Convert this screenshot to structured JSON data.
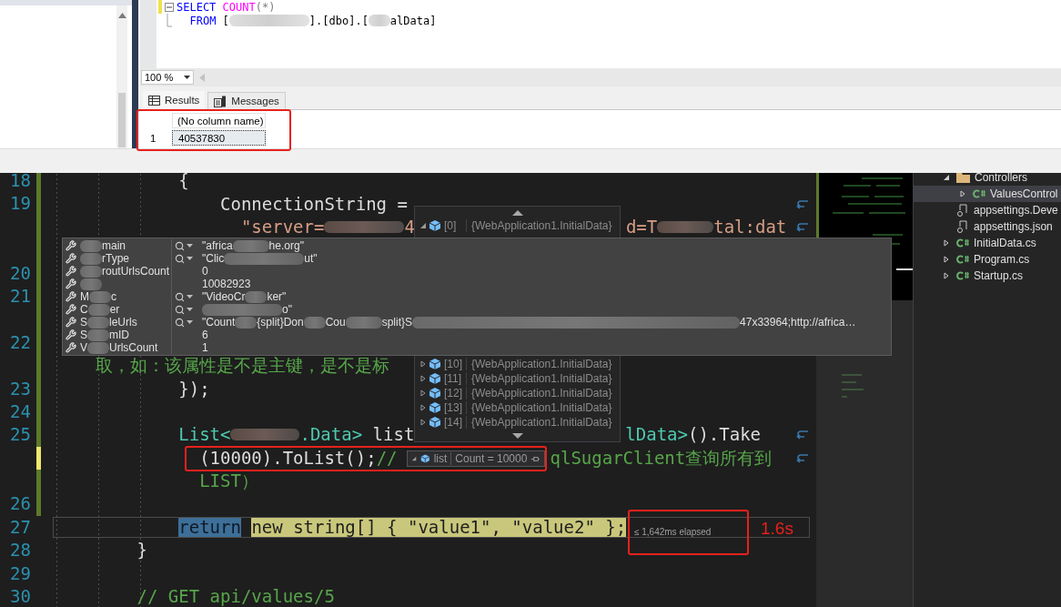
{
  "query_editor": {
    "lines": [
      {
        "changed": true,
        "saved": false,
        "fold": true,
        "segments": [
          {
            "kind": "keyword",
            "text": "SELECT"
          },
          {
            "kind": "function",
            "text": " COUNT"
          },
          {
            "kind": "operator",
            "text": "(*)"
          }
        ]
      },
      {
        "segments": [
          {
            "kind": "keyword",
            "text": "  FROM"
          },
          {
            "kind": "plain",
            "text": " ["
          },
          {
            "kind": "redacted"
          },
          {
            "kind": "plain",
            "text": "].[dbo].["
          },
          {
            "kind": "redacted"
          },
          {
            "kind": "plain",
            "text": "alData]"
          }
        ]
      }
    ]
  },
  "zoom_level": "100 %",
  "result_tabs": [
    {
      "label": "Results",
      "selected": true
    },
    {
      "label": "Messages",
      "selected": false
    }
  ],
  "results": {
    "columns": [
      "(No column name)"
    ],
    "rows": [
      {
        "number": "1",
        "cells": [
          "40537830"
        ],
        "selected": true
      }
    ]
  },
  "code_lines": [
    {
      "number": "18",
      "changed": true,
      "saved": true,
      "segments": [
        {
          "kind": "plain",
          "text": "            {"
        }
      ]
    },
    {
      "number": "19",
      "changed": true,
      "saved": true,
      "wrap": true,
      "segments": [
        {
          "kind": "plain",
          "text": "                ConnectionString ="
        }
      ]
    },
    {
      "changed": true,
      "saved": true,
      "wrap": true,
      "segments": [
        {
          "kind": "string",
          "text": "                  \"server="
        },
        {
          "kind": "redacted"
        },
        {
          "kind": "string",
          "text": "4"
        },
        {
          "kind": "gap"
        },
        {
          "kind": "string",
          "text": "d=T"
        },
        {
          "kind": "redacted"
        },
        {
          "kind": "string",
          "text": "tal:dat"
        }
      ]
    },
    {
      "changed": true,
      "saved": true
    },
    {
      "number": "20",
      "changed": true,
      "saved": true
    },
    {
      "number": "21",
      "changed": true,
      "saved": true
    },
    {
      "changed": true,
      "saved": true
    },
    {
      "number": "22",
      "changed": true,
      "saved": true
    },
    {
      "changed": true,
      "saved": true,
      "segments": [
        {
          "kind": "comment",
          "text": "    取，如：该属性是不是主键，是不是标"
        }
      ]
    },
    {
      "number": "23",
      "changed": true,
      "saved": true,
      "segments": [
        {
          "kind": "plain",
          "text": "            });"
        }
      ]
    },
    {
      "number": "24",
      "changed": true,
      "saved": true
    },
    {
      "number": "25",
      "changed": true,
      "saved": true,
      "wrap": true,
      "segments": [
        {
          "kind": "type",
          "text": "            List<"
        },
        {
          "kind": "redacted"
        },
        {
          "kind": "type",
          "text": ".Data>"
        },
        {
          "kind": "plain",
          "text": " list"
        },
        {
          "kind": "gap"
        },
        {
          "kind": "type",
          "text": "lData>"
        },
        {
          "kind": "plain",
          "text": "().Take"
        }
      ]
    },
    {
      "changed": true,
      "saved": false,
      "wrap": true,
      "segments": [
        {
          "kind": "plain",
          "text": "              (10000).ToList();"
        },
        {
          "kind": "comment",
          "text": "//"
        },
        {
          "kind": "gap"
        },
        {
          "kind": "comment",
          "text": "qlSugarClient查询所有到"
        }
      ]
    },
    {
      "changed": true,
      "saved": true,
      "segments": [
        {
          "kind": "comment",
          "text": "              LIST）"
        }
      ]
    },
    {
      "number": "26",
      "changed": true,
      "saved": true
    },
    {
      "number": "27",
      "current": true,
      "segments": [
        {
          "kind": "selected",
          "text": "            return"
        },
        {
          "kind": "current",
          "text": " new string[] { \"value1\", \"value2\" };"
        }
      ]
    },
    {
      "number": "28",
      "segments": [
        {
          "kind": "plain",
          "text": "        }"
        }
      ]
    },
    {
      "number": "29"
    },
    {
      "number": "30",
      "segments": [
        {
          "kind": "comment",
          "text": "        // GET api/values/5"
        }
      ]
    }
  ],
  "list_dropdown": [
    {
      "index": "[0]",
      "value": "{WebApplication1.InitialData}",
      "expanded": true
    },
    {
      "index": "[10]",
      "value": "{WebApplication1.InitialData}",
      "expanded": false
    },
    {
      "index": "[11]",
      "value": "{WebApplication1.InitialData}",
      "expanded": false
    },
    {
      "index": "[12]",
      "value": "{WebApplication1.InitialData}",
      "expanded": false
    },
    {
      "index": "[13]",
      "value": "{WebApplication1.InitialData}",
      "expanded": false
    },
    {
      "index": "[14]",
      "value": "{WebApplication1.InitialData}",
      "expanded": false
    }
  ],
  "property_tip": [
    {
      "kind": "string",
      "name": [
        {
          "kind": "redacted"
        },
        {
          "kind": "plain",
          "text": "main"
        }
      ],
      "value": [
        {
          "kind": "plain",
          "text": "\"africa"
        },
        {
          "kind": "redacted"
        },
        {
          "kind": "plain",
          "text": "he.org\""
        }
      ]
    },
    {
      "kind": "string",
      "name": [
        {
          "kind": "redacted"
        },
        {
          "kind": "plain",
          "text": "rType"
        }
      ],
      "value": [
        {
          "kind": "plain",
          "text": "\"Clic"
        },
        {
          "kind": "redacted"
        },
        {
          "kind": "plain",
          "text": "ut\""
        }
      ]
    },
    {
      "kind": "number",
      "name": [
        {
          "kind": "redacted"
        },
        {
          "kind": "plain",
          "text": "routUrlsCount"
        }
      ],
      "value": [
        {
          "kind": "plain",
          "text": "0"
        }
      ]
    },
    {
      "kind": "number",
      "name": [
        {
          "kind": "redacted"
        }
      ],
      "value": [
        {
          "kind": "plain",
          "text": "10082923"
        }
      ]
    },
    {
      "kind": "string",
      "name": [
        {
          "kind": "plain",
          "text": "M"
        },
        {
          "kind": "redacted"
        },
        {
          "kind": "plain",
          "text": "c"
        }
      ],
      "value": [
        {
          "kind": "plain",
          "text": "\"VideoCr"
        },
        {
          "kind": "redacted"
        },
        {
          "kind": "plain",
          "text": "ker\""
        }
      ]
    },
    {
      "kind": "string",
      "name": [
        {
          "kind": "plain",
          "text": "C"
        },
        {
          "kind": "redacted"
        },
        {
          "kind": "plain",
          "text": "er"
        }
      ],
      "value": [
        {
          "kind": "redacted"
        },
        {
          "kind": "plain",
          "text": "o\""
        }
      ]
    },
    {
      "kind": "string",
      "name": [
        {
          "kind": "plain",
          "text": "S"
        },
        {
          "kind": "redacted"
        },
        {
          "kind": "plain",
          "text": "leUrls"
        }
      ],
      "value": [
        {
          "kind": "plain",
          "text": "\"Count"
        },
        {
          "kind": "redacted"
        },
        {
          "kind": "plain",
          "text": "{split}Don"
        },
        {
          "kind": "redacted"
        },
        {
          "kind": "plain",
          "text": "Cou"
        },
        {
          "kind": "redacted"
        },
        {
          "kind": "plain",
          "text": "split}S"
        },
        {
          "kind": "redacted"
        },
        {
          "kind": "plain",
          "text": "47x33964;http://africa…"
        }
      ]
    },
    {
      "kind": "number",
      "name": [
        {
          "kind": "plain",
          "text": "S"
        },
        {
          "kind": "redacted"
        },
        {
          "kind": "plain",
          "text": "mID"
        }
      ],
      "value": [
        {
          "kind": "plain",
          "text": "6"
        }
      ]
    },
    {
      "kind": "number",
      "name": [
        {
          "kind": "plain",
          "text": "V"
        },
        {
          "kind": "redacted"
        },
        {
          "kind": "plain",
          "text": "UrlsCount"
        }
      ],
      "value": [
        {
          "kind": "plain",
          "text": "1"
        }
      ]
    }
  ],
  "list_tip": {
    "name": "list",
    "value": "Count = 10000",
    "expanded": true
  },
  "elapsed": "≤ 1,642ms elapsed",
  "annotation_label": "1.6s",
  "solution_explorer": [
    {
      "label": "Controllers",
      "kind": "folder",
      "expanded": true,
      "selected": false,
      "children": [
        {
          "label": "ValuesControl",
          "kind": "csharp",
          "expanded": false,
          "selected": true
        }
      ]
    },
    {
      "label": "appsettings.Deve",
      "kind": "json",
      "selected": false
    },
    {
      "label": "appsettings.json",
      "kind": "json",
      "selected": false
    },
    {
      "label": "InitialData.cs",
      "kind": "csharp",
      "expanded": false,
      "selected": false
    },
    {
      "label": "Program.cs",
      "kind": "csharp",
      "expanded": false,
      "selected": false
    },
    {
      "label": "Startup.cs",
      "kind": "csharp",
      "expanded": false,
      "selected": false
    }
  ]
}
